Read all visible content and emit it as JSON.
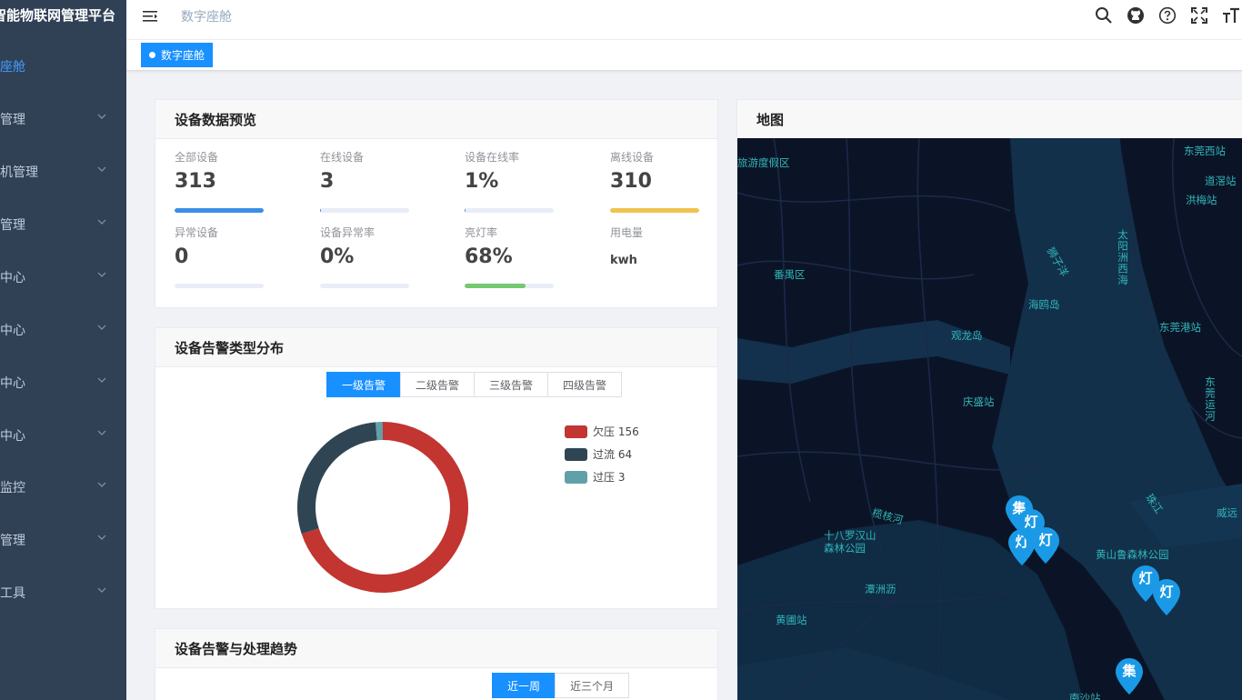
{
  "app": {
    "title": "智能物联网管理平台"
  },
  "sidebar": {
    "items": [
      {
        "label": "字座舱",
        "active": true
      },
      {
        "label": "备管理"
      },
      {
        "label": "像机管理"
      },
      {
        "label": "警管理"
      },
      {
        "label": "略中心"
      },
      {
        "label": "单中心"
      },
      {
        "label": "计中心"
      },
      {
        "label": "置中心"
      },
      {
        "label": "统监控"
      },
      {
        "label": "统管理"
      },
      {
        "label": "统工具"
      }
    ]
  },
  "navbar": {
    "breadcrumb": "数字座舱",
    "icons": [
      "search-icon",
      "github-icon",
      "help-icon",
      "fullscreen-icon",
      "font-size-icon"
    ]
  },
  "tags": {
    "active": "数字座舱"
  },
  "overview": {
    "title": "设备数据预览",
    "stats": [
      {
        "label": "全部设备",
        "value": "313",
        "progress": 1.0,
        "color": "#3a8ee6"
      },
      {
        "label": "在线设备",
        "value": "3",
        "progress": 0.01,
        "color": "#3a8ee6"
      },
      {
        "label": "设备在线率",
        "value": "1%",
        "progress": 0.01,
        "color": "#3a8ee6"
      },
      {
        "label": "离线设备",
        "value": "310",
        "progress": 1.0,
        "color": "#f0c24f"
      },
      {
        "label": "异常设备",
        "value": "0",
        "progress": 0,
        "color": "#3a8ee6"
      },
      {
        "label": "设备异常率",
        "value": "0%",
        "progress": 0,
        "color": "#3a8ee6"
      },
      {
        "label": "亮灯率",
        "value": "68%",
        "progress": 0.68,
        "color": "#72c96f"
      },
      {
        "label": "用电量",
        "value": "kwh",
        "progress": null,
        "color": ""
      }
    ]
  },
  "alarm_types": {
    "title": "设备告警类型分布",
    "tabs": [
      "一级告警",
      "二级告警",
      "三级告警",
      "四级告警"
    ],
    "active_tab": 0
  },
  "chart_data": {
    "type": "pie",
    "donut": true,
    "categories": [
      "欠压",
      "过流",
      "过压"
    ],
    "values": [
      156,
      64,
      3
    ],
    "colors": [
      "#c23531",
      "#2f4554",
      "#61a0a8"
    ],
    "legend_labels": [
      "欠压 156",
      "过流 64",
      "过压 3"
    ],
    "legend": "right"
  },
  "trend": {
    "title": "设备告警与处理趋势",
    "tabs": [
      "近一周",
      "近三个月"
    ],
    "active_tab": 0
  },
  "map": {
    "title": "地图",
    "labels": [
      "旅游度假区",
      "东莞西站",
      "道滘站",
      "洪梅站",
      "番禺区",
      "狮子洋",
      "太阳洲西海",
      "海鸥岛",
      "观龙岛",
      "东莞港站",
      "庆盛站",
      "东莞运河",
      "珠江",
      "威远",
      "榄核河",
      "十八罗汉山森林公园",
      "黄山鲁森林公园",
      "潭洲沥",
      "黄圃站",
      "南沙站"
    ],
    "markers": [
      "集",
      "灯",
      "灯",
      "灯",
      "灯",
      "集"
    ]
  }
}
